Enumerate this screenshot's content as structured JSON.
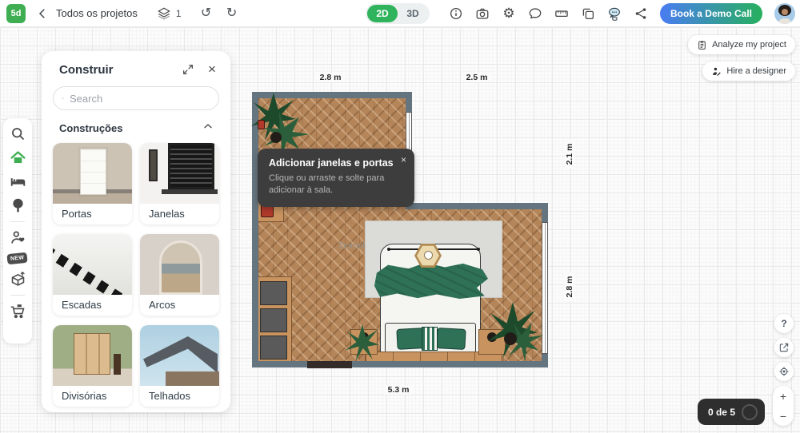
{
  "topbar": {
    "logo_text": "5d",
    "back_label": "Todos os projetos",
    "layers_count": "1",
    "view_2d": "2D",
    "view_3d": "3D",
    "demo_button_label": "Book a Demo Call",
    "icons": [
      "info",
      "camera",
      "settings",
      "chat",
      "ruler",
      "copy",
      "ai-assistant",
      "share"
    ]
  },
  "sidebar": {
    "new_badge": "NEW",
    "icons": [
      "search",
      "build",
      "furniture",
      "plants",
      "people",
      "new",
      "objects",
      "cart"
    ]
  },
  "build_panel": {
    "title": "Construir",
    "search_placeholder": "Search",
    "section_title": "Construções",
    "items": [
      {
        "label": "Portas"
      },
      {
        "label": "Janelas"
      },
      {
        "label": "Escadas"
      },
      {
        "label": "Arcos"
      },
      {
        "label": "Divisórias"
      },
      {
        "label": "Telhados"
      }
    ]
  },
  "tooltip": {
    "title": "Adicionar janelas e portas",
    "body": "Clique ou arraste e solte para adicionar à sala.",
    "close_label": "×"
  },
  "floorplan": {
    "room_label": "Dormitório",
    "dim_top_left": "2.8 m",
    "dim_top_right": "2.5 m",
    "dim_right_top": "2.1 m",
    "dim_right_bottom": "2.8 m",
    "dim_bottom": "5.3 m"
  },
  "overlay": {
    "analyze_label": "Analyze my project",
    "hire_label": "Hire a designer"
  },
  "hud": {
    "counter": "0 de 5",
    "zoom_in": "+",
    "zoom_out": "−",
    "help": "?"
  },
  "colors": {
    "brand_green": "#3fae52",
    "active_toggle_green": "#2fb35c",
    "demo_gradient_start": "#4a7cf2",
    "demo_gradient_end": "#27b05e",
    "wall": "#65757f",
    "floor_wood": "#b5855a",
    "blanket_green": "#2e7156",
    "tooltip_bg": "#3d3d3d"
  }
}
